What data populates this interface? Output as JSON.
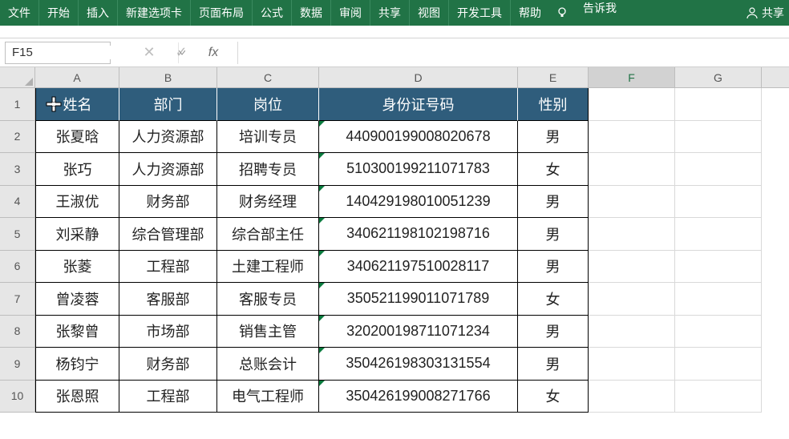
{
  "ribbon": {
    "tabs": [
      "文件",
      "开始",
      "插入",
      "新建选项卡",
      "页面布局",
      "公式",
      "数据",
      "审阅",
      "共享",
      "视图",
      "开发工具",
      "帮助"
    ],
    "tell_me": "告诉我",
    "share": "共享"
  },
  "namebox": {
    "value": "F15"
  },
  "formula": {
    "fx": "fx",
    "cancel": "✕",
    "enter": "✓",
    "value": ""
  },
  "columns": [
    "A",
    "B",
    "C",
    "D",
    "E",
    "F",
    "G"
  ],
  "row_numbers": [
    1,
    2,
    3,
    4,
    5,
    6,
    7,
    8,
    9,
    10
  ],
  "table_headers": [
    "姓名",
    "部门",
    "岗位",
    "身份证号码",
    "性别"
  ],
  "table_rows": [
    [
      "张夏晗",
      "人力资源部",
      "培训专员",
      "440900199008020678",
      "男"
    ],
    [
      "张巧",
      "人力资源部",
      "招聘专员",
      "510300199211071783",
      "女"
    ],
    [
      "王淑优",
      "财务部",
      "财务经理",
      "140429198010051239",
      "男"
    ],
    [
      "刘采静",
      "综合管理部",
      "综合部主任",
      "340621198102198716",
      "男"
    ],
    [
      "张菱",
      "工程部",
      "土建工程师",
      "340621197510028117",
      "男"
    ],
    [
      "曾凌蓉",
      "客服部",
      "客服专员",
      "350521199011071789",
      "女"
    ],
    [
      "张黎曾",
      "市场部",
      "销售主管",
      "320200198711071234",
      "男"
    ],
    [
      "杨钧宁",
      "财务部",
      "总账会计",
      "350426198303131554",
      "男"
    ],
    [
      "张恩照",
      "工程部",
      "电气工程师",
      "350426199008271766",
      "女"
    ]
  ],
  "active_cell": "F15",
  "active_column": "F"
}
